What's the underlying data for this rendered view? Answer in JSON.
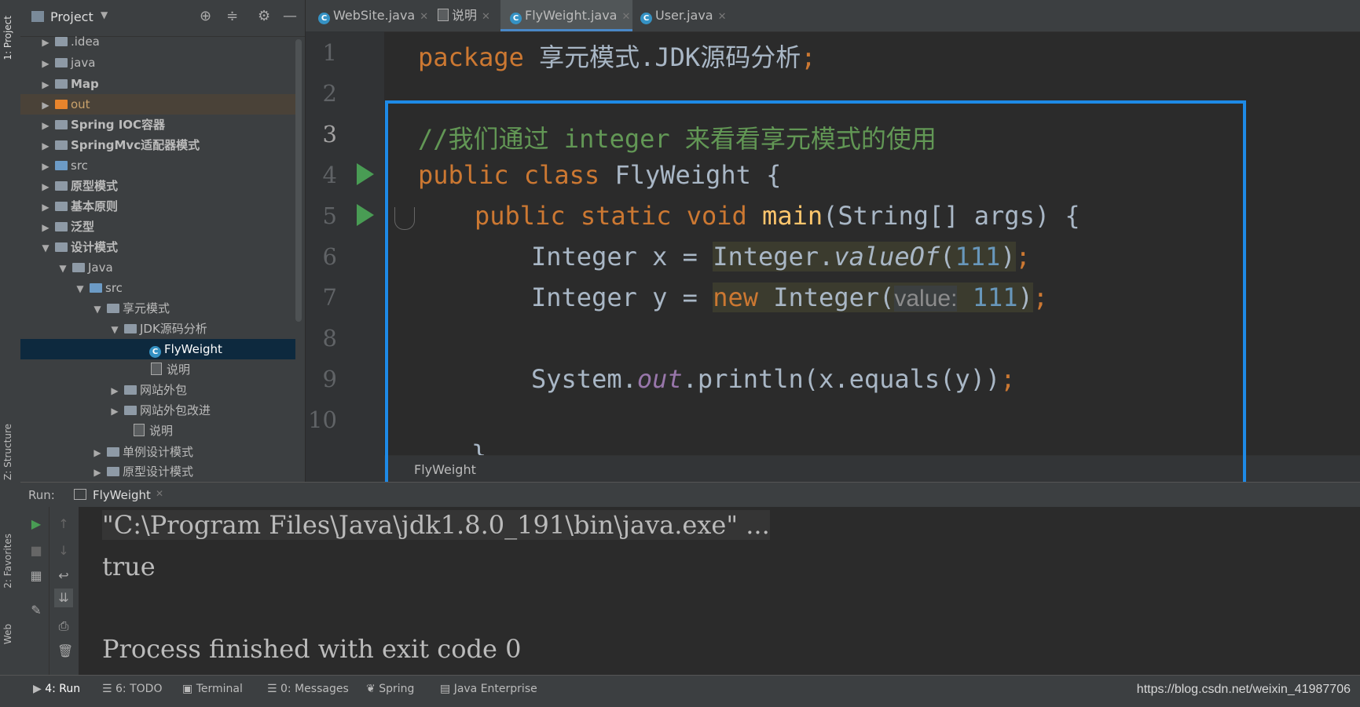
{
  "left_strip": {
    "project_tab": "1: Project",
    "structure_tab": "Z: Structure",
    "favorites_tab": "2: Favorites",
    "web_tab": "Web"
  },
  "project_panel": {
    "title": "Project",
    "items": [
      {
        "label": ".idea"
      },
      {
        "label": "java"
      },
      {
        "label": "Map"
      },
      {
        "label": "out"
      },
      {
        "label": "Spring IOC容器"
      },
      {
        "label": "SpringMvc适配器模式"
      },
      {
        "label": "src"
      },
      {
        "label": "原型模式"
      },
      {
        "label": "基本原则"
      },
      {
        "label": "泛型"
      },
      {
        "label": "设计模式"
      },
      {
        "label": "Java"
      },
      {
        "label": "src"
      },
      {
        "label": "享元模式"
      },
      {
        "label": "JDK源码分析"
      },
      {
        "label": "FlyWeight"
      },
      {
        "label": "说明"
      },
      {
        "label": "网站外包"
      },
      {
        "label": "网站外包改进"
      },
      {
        "label": "说明"
      },
      {
        "label": "单例设计模式"
      },
      {
        "label": "原型设计模式"
      }
    ]
  },
  "editor_tabs": [
    {
      "label": "WebSite.java"
    },
    {
      "label": "说明"
    },
    {
      "label": "FlyWeight.java"
    },
    {
      "label": "User.java"
    }
  ],
  "editor": {
    "line_numbers": [
      "1",
      "2",
      "3",
      "4",
      "5",
      "6",
      "7",
      "8",
      "9",
      "10"
    ],
    "line1_kw": "package",
    "line1_rest": " 享元模式.JDK源码分析",
    "line1_semi": ";",
    "line3_comment": "//我们通过 integer 来看看享元模式的使用",
    "line4_kw": "public class",
    "line4_rest": " FlyWeight {",
    "line5_kw": "public static void",
    "line5_fn": " main",
    "line5_rest": "(String[] args) {",
    "line6_a": "Integer x = ",
    "line6_b": "Integer.",
    "line6_c": "valueOf",
    "line6_d": "(",
    "line6_num": "111",
    "line6_e": ")",
    "line6_semi": ";",
    "line7_a": "Integer y = ",
    "line7_kw": "new",
    "line7_b": " Integer(",
    "line7_hint": "value:",
    "line7_num": " 111",
    "line7_c": ")",
    "line7_semi": ";",
    "line9_a": "System.",
    "line9_out": "out",
    "line9_b": ".println(x.equals(y))",
    "line9_semi": ";",
    "line10_partial": "}",
    "breadcrumb": "FlyWeight"
  },
  "run_panel": {
    "label": "Run:",
    "tab": "FlyWeight",
    "console_lines": [
      "\"C:\\Program Files\\Java\\jdk1.8.0_191\\bin\\java.exe\" ...",
      "true",
      "",
      "Process finished with exit code 0"
    ]
  },
  "bottom_bar": {
    "tabs": [
      {
        "label": "4: Run"
      },
      {
        "label": "6: TODO"
      },
      {
        "label": "Terminal"
      },
      {
        "label": "0: Messages"
      },
      {
        "label": "Spring"
      },
      {
        "label": "Java Enterprise"
      }
    ],
    "url": "https://blog.csdn.net/weixin_41987706"
  }
}
